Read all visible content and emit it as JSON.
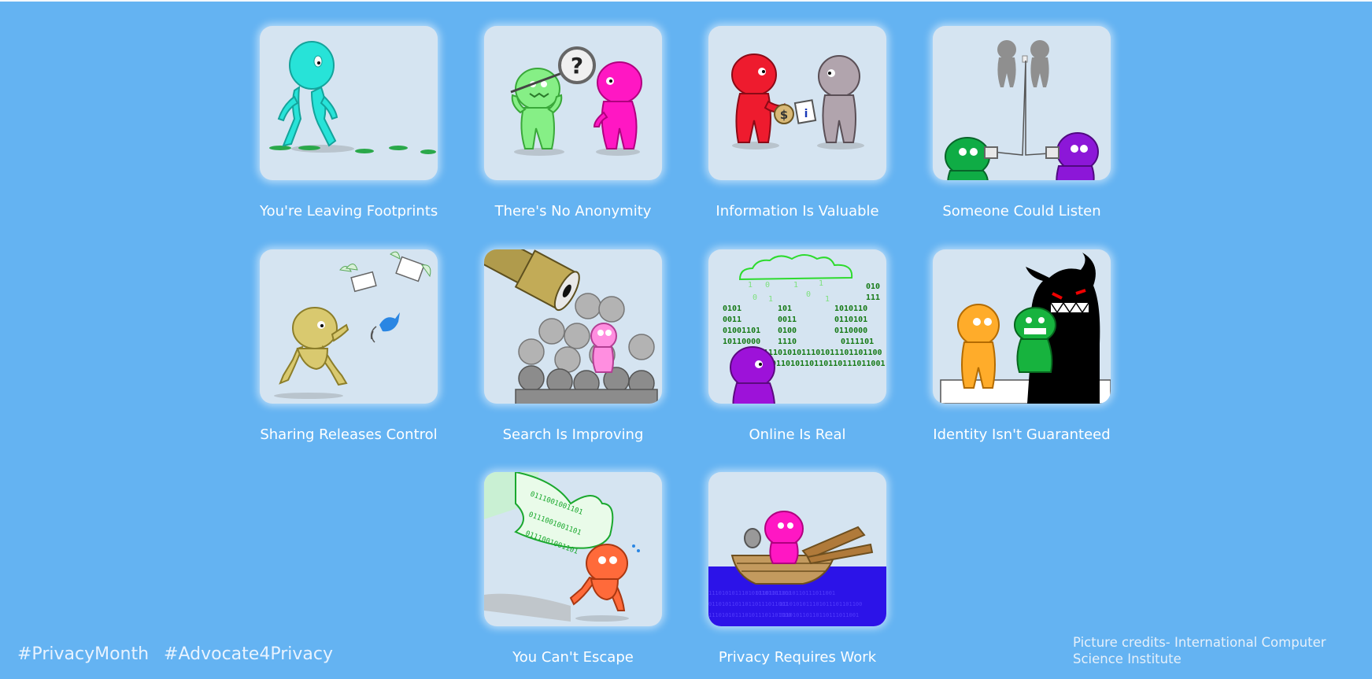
{
  "tiles": [
    {
      "caption": "You're Leaving Footprints",
      "icon": "footprints-illustration"
    },
    {
      "caption": "There's No Anonymity",
      "icon": "magnifying-glass-illustration"
    },
    {
      "caption": "Information Is Valuable",
      "icon": "money-exchange-illustration"
    },
    {
      "caption": "Someone Could Listen",
      "icon": "tin-can-phone-illustration"
    },
    {
      "caption": "Sharing Releases Control",
      "icon": "flying-messages-illustration"
    },
    {
      "caption": "Search Is Improving",
      "icon": "telescope-crowd-illustration"
    },
    {
      "caption": "Online Is Real",
      "icon": "binary-rain-illustration"
    },
    {
      "caption": "Identity Isn't Guaranteed",
      "icon": "shadow-monster-illustration"
    },
    {
      "caption": "You Can't Escape",
      "icon": "binary-hand-illustration"
    },
    {
      "caption": "Privacy Requires Work",
      "icon": "rowing-boat-illustration"
    }
  ],
  "binary": {
    "rain": [
      "010",
      "111",
      "0101",
      "0011",
      "01001101",
      "10110000",
      "1010110",
      "0110101",
      "0110000",
      "0111101",
      "101",
      "0100",
      "1110",
      "0011"
    ],
    "long": "1110101011101011101101100",
    "long2": "011010110110110111011001",
    "hand": "0111001001101"
  },
  "dollar_sign": "$",
  "info_sign": "i",
  "question_mark": "?",
  "footer": {
    "hashtags": [
      "#PrivacyMonth",
      "#Advocate4Privacy"
    ],
    "credits": "Picture credits- International Computer Science Institute"
  },
  "colors": {
    "background": "#64b3f2",
    "tile": "#d5e4f1",
    "caption": "#ffffff"
  }
}
